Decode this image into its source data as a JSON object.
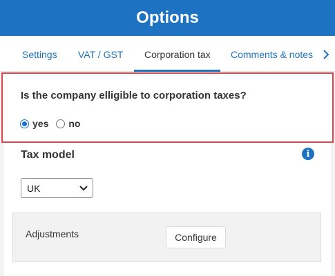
{
  "header": {
    "title": "Options"
  },
  "tabs": [
    {
      "label": "Settings"
    },
    {
      "label": "VAT / GST"
    },
    {
      "label": "Corporation tax"
    },
    {
      "label": "Comments & notes"
    }
  ],
  "active_tab": "Corporation tax",
  "question": {
    "text": "Is the company elligible to corporation taxes?",
    "options": [
      {
        "label": "yes",
        "checked": true
      },
      {
        "label": "no",
        "checked": false
      }
    ]
  },
  "tax_model": {
    "title": "Tax model",
    "selected": "UK",
    "info_icon": "info-icon"
  },
  "adjustments": {
    "label": "Adjustments",
    "button_label": "Configure"
  },
  "colors": {
    "accent": "#1d73c1",
    "highlight_border": "#e0434b"
  }
}
